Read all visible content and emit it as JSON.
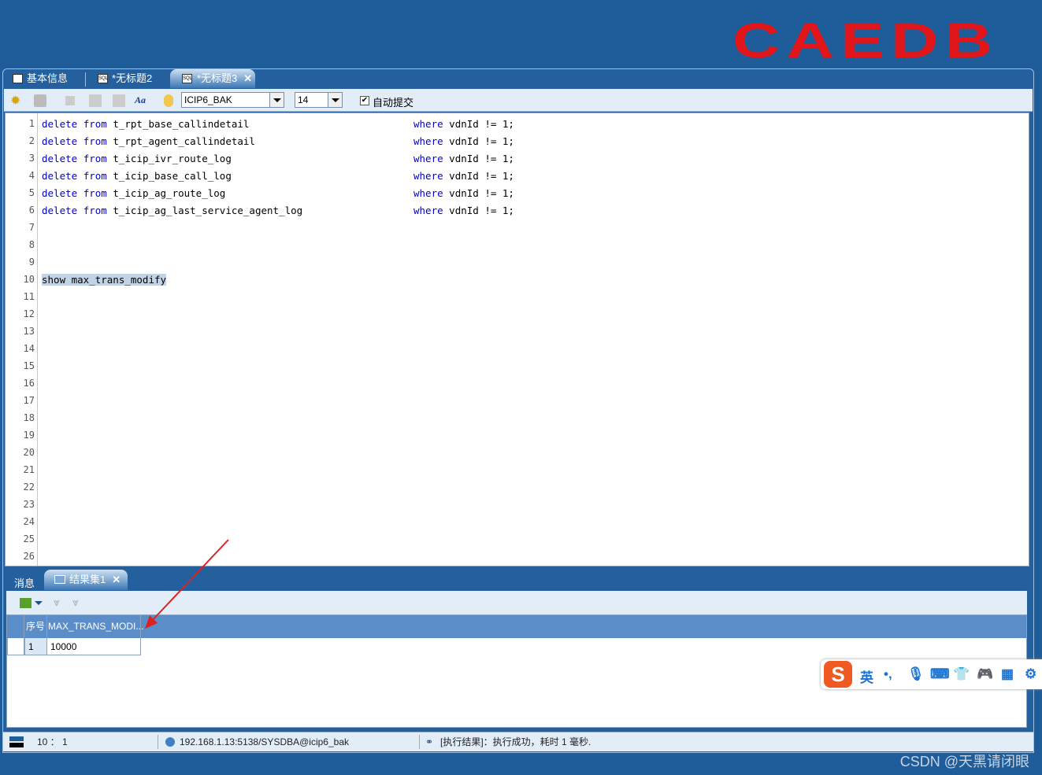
{
  "logo": "CAEDB",
  "tabs": [
    {
      "label": "基本信息",
      "icon": "document-icon"
    },
    {
      "label": "*无标题2",
      "icon": "sql-icon"
    },
    {
      "label": "*无标题3",
      "icon": "sql-icon",
      "active": true
    }
  ],
  "toolbar": {
    "database": "ICIP6_BAK",
    "font_size": "14",
    "autocommit_label": "自动提交",
    "autocommit_checked": true
  },
  "editor": {
    "lines": [
      {
        "n": "1",
        "a": "t_rpt_base_callindetail"
      },
      {
        "n": "2",
        "a": "t_rpt_agent_callindetail"
      },
      {
        "n": "3",
        "a": "t_icip_ivr_route_log"
      },
      {
        "n": "4",
        "a": "t_icip_base_call_log"
      },
      {
        "n": "5",
        "a": "t_icip_ag_route_log"
      },
      {
        "n": "6",
        "a": "t_icip_ag_last_service_agent_log"
      }
    ],
    "kw_delete": "delete",
    "kw_from": "from",
    "kw_where": "where",
    "cond": "vdnId != 1;",
    "selected_line": "show max_trans_modify",
    "line_numbers": [
      "1",
      "2",
      "3",
      "4",
      "5",
      "6",
      "7",
      "8",
      "9",
      "10",
      "11",
      "12",
      "13",
      "14",
      "15",
      "16",
      "17",
      "18",
      "19",
      "20",
      "21",
      "22",
      "23",
      "24",
      "25",
      "26"
    ]
  },
  "results": {
    "tabs": [
      "消息",
      "结果集1"
    ],
    "columns": [
      "序号",
      "MAX_TRANS_MODI..."
    ],
    "rows": [
      [
        "1",
        "10000"
      ]
    ]
  },
  "status": {
    "position": "10 ： 1",
    "connection": "192.168.1.13:5138/SYSDBA@icip6_bak",
    "message": "[执行结果]：执行成功，耗时 1 毫秒."
  },
  "ime": {
    "mode": "英"
  },
  "watermark": "CSDN @天黑请闭眼"
}
